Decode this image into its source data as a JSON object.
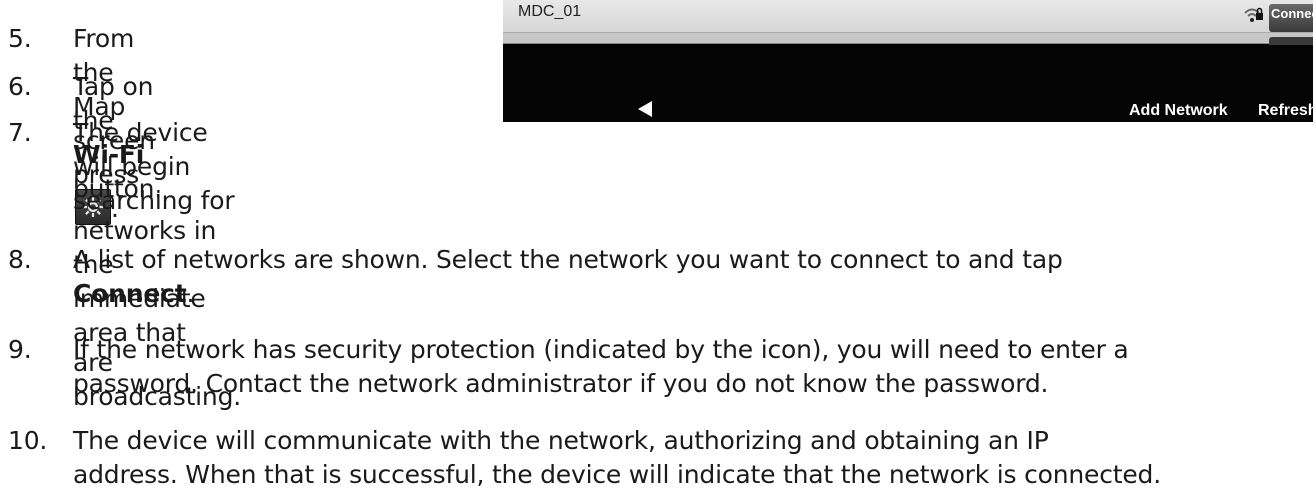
{
  "steps": [
    {
      "number": "5.",
      "pre": "From the Map screen press",
      "post": "."
    },
    {
      "number": "6.",
      "pre": "Tap on the ",
      "bold": "Wi-Fi",
      "post": " button."
    },
    {
      "number": "7.",
      "lines": [
        "The device will begin searching for",
        "networks in the immediate area that",
        "are broadcasting."
      ]
    },
    {
      "number": "8.",
      "line1": "A list of networks are shown. Select the network you want to connect to and tap",
      "bold": "Connect",
      "post": "."
    },
    {
      "number": "9.",
      "lines": [
        "If the network has security protection (indicated by the icon), you will need to enter a",
        "password. Contact the network administrator if you do not know the password."
      ]
    },
    {
      "number": "10.",
      "lines": [
        "The device will communicate with the network, authorizing and obtaining an IP",
        "address. When that is successful, the device will indicate that the network is connected."
      ]
    }
  ],
  "screenshot": {
    "network_name": "MDC_01",
    "connect_label": "Connect",
    "add_network_label": "Add Network",
    "refresh_label": "Refresh"
  }
}
